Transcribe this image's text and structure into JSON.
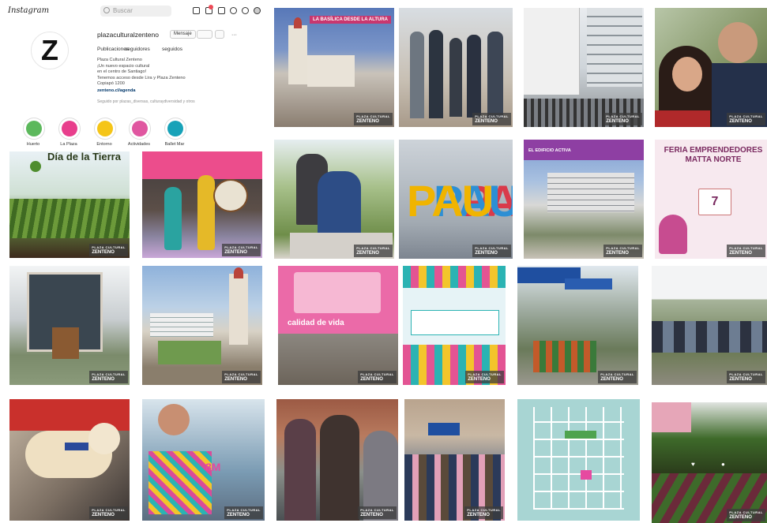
{
  "app": {
    "logo": "Instagram",
    "search_placeholder": "Buscar"
  },
  "profile": {
    "avatar_letter": "Z",
    "username": "plazaculturalzenteno",
    "edit_button": "Mensaje",
    "stats": {
      "posts": "Publicaciones",
      "followers": "seguidores",
      "following": "seguidos"
    },
    "bio": [
      "Plaza Cultural Zenteno",
      "¡Un nuevo espacio cultural",
      "en el centro de Santiago!",
      "Tenemos acceso desde Lira y Plaza Zenteno",
      "Copiapó 1200"
    ],
    "link": "zenteno.cl/agenda",
    "followed_by": "Seguido por plazas_diversas, culturaydiversidad y otros"
  },
  "highlights": [
    {
      "label": "Huerto",
      "color": "#5cb85c"
    },
    {
      "label": "La Plaza",
      "color": "#e83e8c"
    },
    {
      "label": "Entorno",
      "color": "#f5c518"
    },
    {
      "label": "Actividades",
      "color": "#e056a0"
    },
    {
      "label": "Ballet Mar",
      "color": "#17a2b8"
    }
  ],
  "badge": {
    "top": "PLAZA CULTURAL",
    "bottom": "ZENTENO"
  },
  "posts": [
    {
      "caption": "LA BASÍLICA DESDE LA ALTURA"
    },
    {
      "caption": ""
    },
    {
      "caption": ""
    },
    {
      "caption": ""
    },
    {
      "caption": "Día de la Tierra"
    },
    {
      "caption": ""
    },
    {
      "caption": ""
    },
    {
      "caption": "PAU"
    },
    {
      "caption": "EL EDIFICIO ACTIVA"
    },
    {
      "caption": "FERIA EMPRENDEDORES MATTA NORTE"
    },
    {
      "caption": ""
    },
    {
      "caption": ""
    },
    {
      "caption": "calidad de vida"
    },
    {
      "caption": ""
    },
    {
      "caption": ""
    },
    {
      "caption": ""
    },
    {
      "caption": ""
    },
    {
      "caption": "8M"
    },
    {
      "caption": ""
    },
    {
      "caption": ""
    },
    {
      "caption": ""
    },
    {
      "caption": ""
    }
  ]
}
